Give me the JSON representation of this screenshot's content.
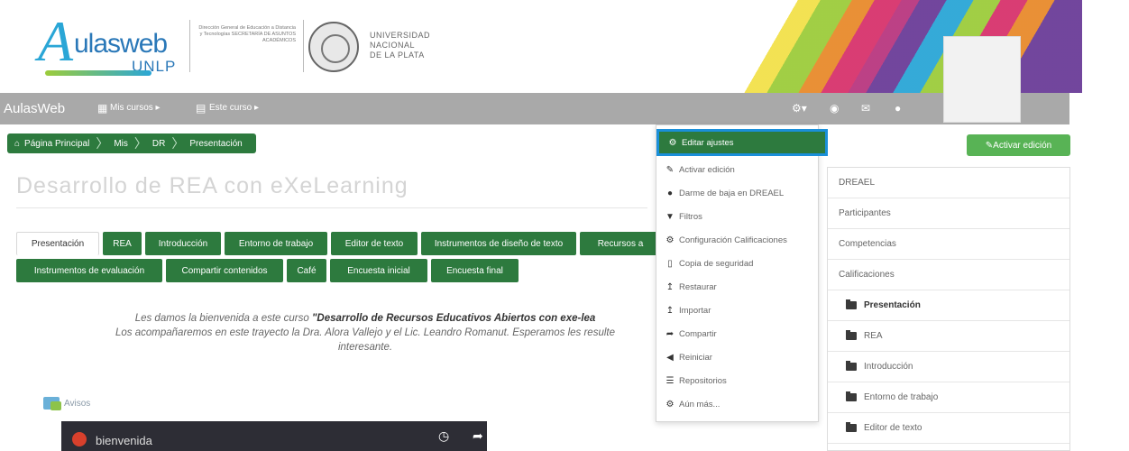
{
  "header": {
    "logo_word": "ulasweb",
    "logo_unlp": "UNLP",
    "direccion_text": "Dirección General de Educación a Distancia y Tecnologías SECRETARÍA DE ASUNTOS ACADÉMICOS",
    "university": [
      "UNIVERSIDAD",
      "NACIONAL",
      "DE LA PLATA"
    ]
  },
  "navbar": {
    "brand": "AulasWeb",
    "mis_cursos": "Mis cursos ▸",
    "este_curso": "Este curso ▸"
  },
  "breadcrumb": [
    "Página Principal",
    "Mis",
    "DR",
    "Presentación"
  ],
  "activar_edicion_button": "Activar edición",
  "course_title": "Desarrollo de REA con eXeLearning",
  "tabs": [
    "Presentación",
    "REA",
    "Introducción",
    "Entorno de trabajo",
    "Editor de texto",
    "Instrumentos de diseño de texto",
    "Recursos a",
    "Instrumentos de evaluación",
    "Compartir contenidos",
    "Café",
    "Encuesta inicial",
    "Encuesta final"
  ],
  "welcome": {
    "line1_pre": "Les damos la bienvenida a este curso ",
    "line1_bold": "\"Desarrollo de Recursos Educativos Abiertos con exe-lea",
    "line2": "Los acompañaremos en este trayecto la Dra. Alora Vallejo y el Lic. Leandro Romanut. Esperamos les resulte",
    "line3": "interesante."
  },
  "avisos": "Avisos",
  "video": {
    "title": "bienvenida"
  },
  "dropdown_menu": [
    {
      "icon": "gear-icon",
      "label": "Editar ajustes"
    },
    {
      "icon": "pencil-icon",
      "label": "Activar edición"
    },
    {
      "icon": "user-icon",
      "label": "Darme de baja en DREAEL"
    },
    {
      "icon": "filter-icon",
      "label": "Filtros"
    },
    {
      "icon": "gear-icon",
      "label": "Configuración Calificaciones"
    },
    {
      "icon": "file-icon",
      "label": "Copia de seguridad"
    },
    {
      "icon": "upload-icon",
      "label": "Restaurar"
    },
    {
      "icon": "upload-icon",
      "label": "Importar"
    },
    {
      "icon": "share-icon",
      "label": "Compartir"
    },
    {
      "icon": "arrow-left-icon",
      "label": "Reiniciar"
    },
    {
      "icon": "repository-icon",
      "label": "Repositorios"
    },
    {
      "icon": "gear-icon",
      "label": "Aún más..."
    }
  ],
  "side_nav": [
    {
      "label": "DREAEL",
      "sub": false
    },
    {
      "label": "Participantes",
      "sub": false
    },
    {
      "label": "Competencias",
      "sub": false
    },
    {
      "label": "Calificaciones",
      "sub": false
    },
    {
      "label": "Presentación",
      "sub": true
    },
    {
      "label": "REA",
      "sub": true
    },
    {
      "label": "Introducción",
      "sub": true
    },
    {
      "label": "Entorno de trabajo",
      "sub": true
    },
    {
      "label": "Editor de texto",
      "sub": true
    }
  ],
  "colors": {
    "primary_green": "#2d7a3e",
    "button_green": "#58b355",
    "navbar_gray": "#a9a9a9",
    "highlight_blue": "#1a8fd9"
  }
}
